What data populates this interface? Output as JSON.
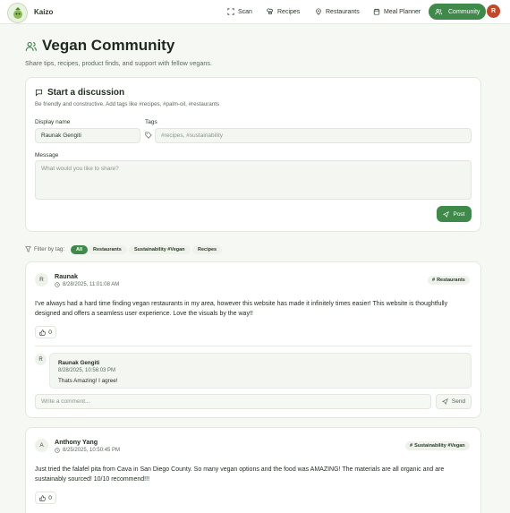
{
  "app": {
    "brand": "Kaizo",
    "avatar_initial": "R"
  },
  "nav": [
    {
      "label": "Scan",
      "icon": "scan-icon"
    },
    {
      "label": "Recipes",
      "icon": "chef-hat-icon"
    },
    {
      "label": "Restaurants",
      "icon": "map-pin-icon"
    },
    {
      "label": "Meal Planner",
      "icon": "calendar-icon"
    },
    {
      "label": "Community",
      "icon": "users-icon",
      "active": true
    }
  ],
  "page": {
    "title": "Vegan Community",
    "subtitle": "Share tips, recipes, product finds, and support with fellow vegans."
  },
  "compose": {
    "title": "Start a discussion",
    "hint": "Be friendly and constructive. Add tags like #recipes, #palm-oil, #restaurants",
    "display_name_label": "Display name",
    "display_name_value": "Raunak Gengiti",
    "tags_label": "Tags",
    "tags_placeholder": "#recipes, #sustainability",
    "message_label": "Message",
    "message_placeholder": "What would you like to share?",
    "post_label": "Post"
  },
  "filter": {
    "label": "Filter by tag:",
    "tags": [
      "All",
      "Restaurants",
      "Sustainability #Vegan",
      "Recipes"
    ]
  },
  "posts": [
    {
      "initial": "R",
      "author": "Raunak",
      "time": "8/28/2025, 11:01:08 AM",
      "tag": "Restaurants",
      "body": "I've always had a hard time finding vegan restaurants in my area, however this website has made it infinitely times easier! This website is thoughtfully designed and offers a seamless user experience. Love the visuals by the way!!",
      "likes": "0",
      "comments": [
        {
          "initial": "R",
          "author": "Raunak Gengiti",
          "time": "8/28/2025, 10:56:03 PM",
          "text": "Thats Amazing! I agree!"
        }
      ],
      "comment_placeholder": "Write a comment...",
      "send_label": "Send"
    },
    {
      "initial": "A",
      "author": "Anthony Yang",
      "time": "8/25/2025, 10:50:45 PM",
      "tag": "Sustainability #Vegan",
      "body": "Just tried the falafel pita from Cava in San Diego County. So many vegan options and the food was AMAZING! The materials are all organic and are sustainably sourced! 10/10 recommend!!!",
      "likes": "0"
    }
  ],
  "colors": {
    "accent": "#3f8a4b",
    "avatar": "#c0492b",
    "background": "#f6f8f4"
  }
}
